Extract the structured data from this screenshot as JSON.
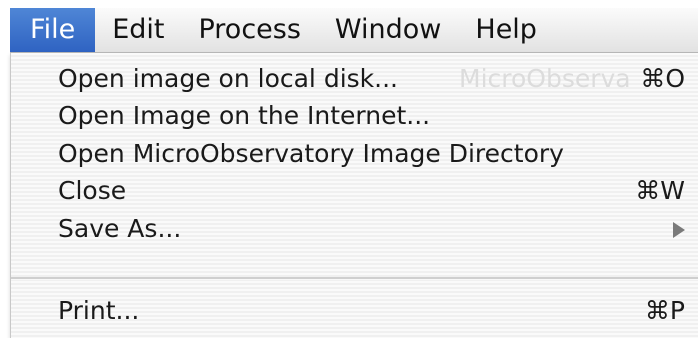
{
  "menubar": {
    "items": [
      {
        "label": "File",
        "active": true
      },
      {
        "label": "Edit",
        "active": false
      },
      {
        "label": "Process",
        "active": false
      },
      {
        "label": "Window",
        "active": false
      },
      {
        "label": "Help",
        "active": false
      }
    ]
  },
  "file_menu": {
    "background_text": "MicroObserva",
    "items": [
      {
        "label": "Open image on local disk...",
        "shortcut": "⌘O"
      },
      {
        "label": "Open Image on the Internet..."
      },
      {
        "label": "Open MicroObservatory Image Directory"
      },
      {
        "label": "Close",
        "shortcut": "⌘W"
      },
      {
        "label": "Save As...",
        "submenu_icon": "triangle-right-icon"
      },
      {
        "label": "Print...",
        "shortcut": "⌘P"
      }
    ]
  },
  "colors": {
    "active_menu": "#2f63c2",
    "active_menu_text": "#ffffff",
    "menu_text": "#1a1a1a"
  }
}
